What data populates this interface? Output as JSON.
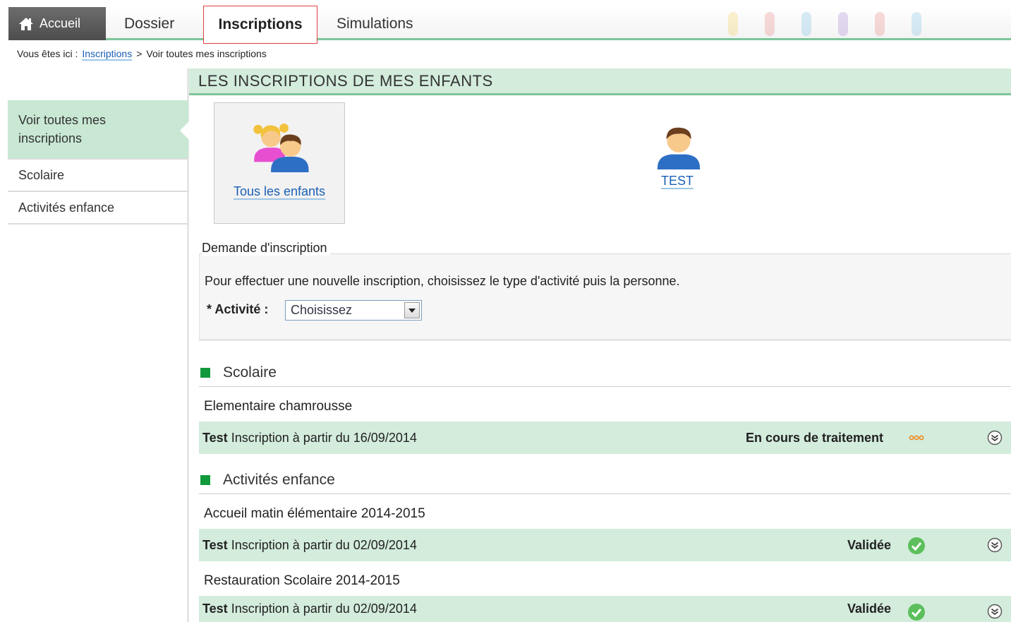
{
  "nav": {
    "home": "Accueil",
    "dossier": "Dossier",
    "inscriptions": "Inscriptions",
    "simulations": "Simulations"
  },
  "breadcrumb": {
    "prefix": "Vous êtes ici :",
    "link": "Inscriptions",
    "separator": ">",
    "current": "Voir toutes mes inscriptions"
  },
  "sidebar": {
    "items": [
      {
        "label": "Voir toutes mes inscriptions",
        "active": true
      },
      {
        "label": "Scolaire",
        "active": false
      },
      {
        "label": "Activités enfance",
        "active": false
      }
    ]
  },
  "section_title": "LES INSCRIPTIONS DE MES ENFANTS",
  "children": {
    "all": "Tous les enfants",
    "child": "TEST"
  },
  "demande": {
    "legend": "Demande d'inscription",
    "text": "Pour effectuer une nouvelle inscription, choisissez le type d'activité puis la personne.",
    "activite_label": "* Activité :",
    "activite_value": "Choisissez"
  },
  "categories": [
    {
      "title": "Scolaire",
      "activities": [
        {
          "name": "Elementaire chamrousse",
          "row": {
            "person": "Test",
            "text": "Inscription à partir du 16/09/2014",
            "status": "En cours de traitement",
            "status_icon": "pending-dots-icon"
          }
        }
      ]
    },
    {
      "title": "Activités enfance",
      "activities": [
        {
          "name": "Accueil matin élémentaire 2014-2015",
          "row": {
            "person": "Test",
            "text": "Inscription à partir du 02/09/2014",
            "status": "Validée",
            "status_icon": "check-circle-icon"
          }
        },
        {
          "name": "Restauration Scolaire 2014-2015",
          "row": {
            "person": "Test",
            "text": "Inscription à partir du 02/09/2014",
            "status": "Validée",
            "status_icon": "check-circle-icon"
          }
        }
      ]
    }
  ],
  "colors": {
    "accent_green": "#7cc59a",
    "row_green": "#d3ecdc",
    "link_blue": "#1a5fb4",
    "active_tab_border": "#e04040",
    "category_square": "#119a3c",
    "status_valid": "#5cbf5c",
    "status_pending": "#f08a1c"
  }
}
